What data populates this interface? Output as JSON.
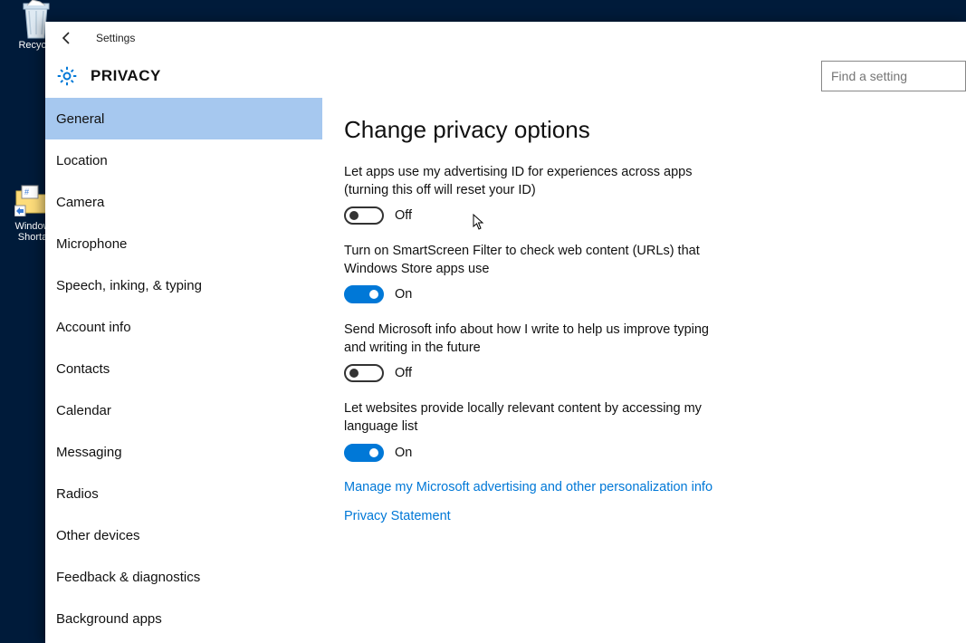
{
  "desktop": {
    "icons": [
      {
        "name": "recycle-bin",
        "label": "Recycle"
      },
      {
        "name": "windows-shortcut",
        "label": "Window\nShorta"
      }
    ]
  },
  "window": {
    "title": "Settings",
    "page": "PRIVACY",
    "search_placeholder": "Find a setting"
  },
  "sidebar": {
    "items": [
      "General",
      "Location",
      "Camera",
      "Microphone",
      "Speech, inking, & typing",
      "Account info",
      "Contacts",
      "Calendar",
      "Messaging",
      "Radios",
      "Other devices",
      "Feedback & diagnostics",
      "Background apps"
    ],
    "selected_index": 0
  },
  "content": {
    "heading": "Change privacy options",
    "options": [
      {
        "desc": "Let apps use my advertising ID for experiences across apps (turning this off will reset your ID)",
        "state": "Off",
        "on": false
      },
      {
        "desc": "Turn on SmartScreen Filter to check web content (URLs) that Windows Store apps use",
        "state": "On",
        "on": true
      },
      {
        "desc": "Send Microsoft info about how I write to help us improve typing and writing in the future",
        "state": "Off",
        "on": false
      },
      {
        "desc": "Let websites provide locally relevant content by accessing my language list",
        "state": "On",
        "on": true
      }
    ],
    "links": [
      "Manage my Microsoft advertising and other personalization info",
      "Privacy Statement"
    ]
  }
}
